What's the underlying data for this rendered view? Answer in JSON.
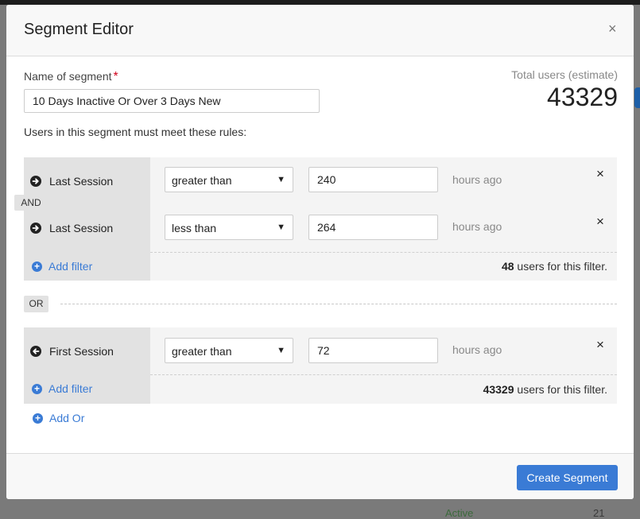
{
  "modal": {
    "title": "Segment Editor",
    "close_symbol": "×"
  },
  "segment": {
    "name_label": "Name of segment",
    "required_marker": "*",
    "name_value": "10 Days Inactive Or Over 3 Days New",
    "total_label": "Total users (estimate)",
    "total_value": "43329",
    "rules_label": "Users in this segment must meet these rules:"
  },
  "and_label": "AND",
  "or_label": "OR",
  "groups": [
    {
      "rules": [
        {
          "icon": "arrow-right-circle-icon",
          "criterion": "Last Session",
          "operator": "greater than",
          "value": "240",
          "unit": "hours ago"
        },
        {
          "icon": "arrow-right-circle-icon",
          "criterion": "Last Session",
          "operator": "less than",
          "value": "264",
          "unit": "hours ago"
        }
      ],
      "add_filter": "Add filter",
      "count": "48",
      "count_suffix": " users for this filter."
    },
    {
      "rules": [
        {
          "icon": "arrow-left-circle-icon",
          "criterion": "First Session",
          "operator": "greater than",
          "value": "72",
          "unit": "hours ago"
        }
      ],
      "add_filter": "Add filter",
      "count": "43329",
      "count_suffix": " users for this filter."
    }
  ],
  "add_or": "Add Or",
  "remove_symbol": "×",
  "footer": {
    "create_label": "Create Segment"
  },
  "background": {
    "active_label": "Active",
    "count": "21"
  },
  "colors": {
    "accent": "#3a7bd5",
    "required": "#d0021b"
  }
}
